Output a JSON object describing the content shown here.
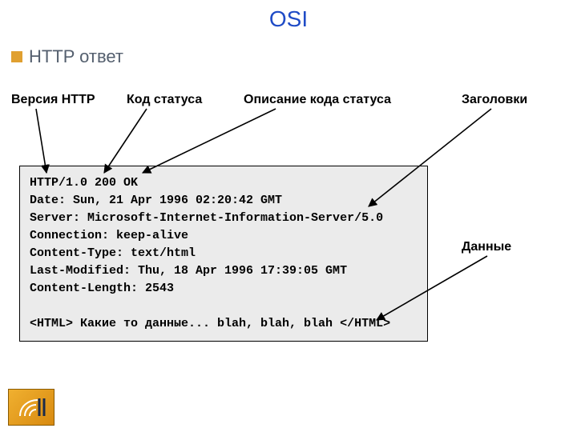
{
  "page_title": "OSI",
  "section": {
    "title": "HTTP ответ"
  },
  "labels": {
    "http_version": "Версия HTTP",
    "status_code": "Код статуса",
    "status_desc": "Описание кода статуса",
    "headers": "Заголовки",
    "data": "Данные"
  },
  "response": {
    "status_line": "HTTP/1.0 200 OK",
    "header_lines": [
      "Date: Sun, 21 Apr 1996 02:20:42 GMT",
      "Server: Microsoft-Internet-Information-Server/5.0",
      "Connection: keep-alive",
      "Content-Type: text/html",
      "Last-Modified: Thu, 18 Apr 1996 17:39:05 GMT",
      "Content-Length: 2543"
    ],
    "body_line": "<HTML> Какие то данные... blah, blah, blah </HTML>"
  }
}
